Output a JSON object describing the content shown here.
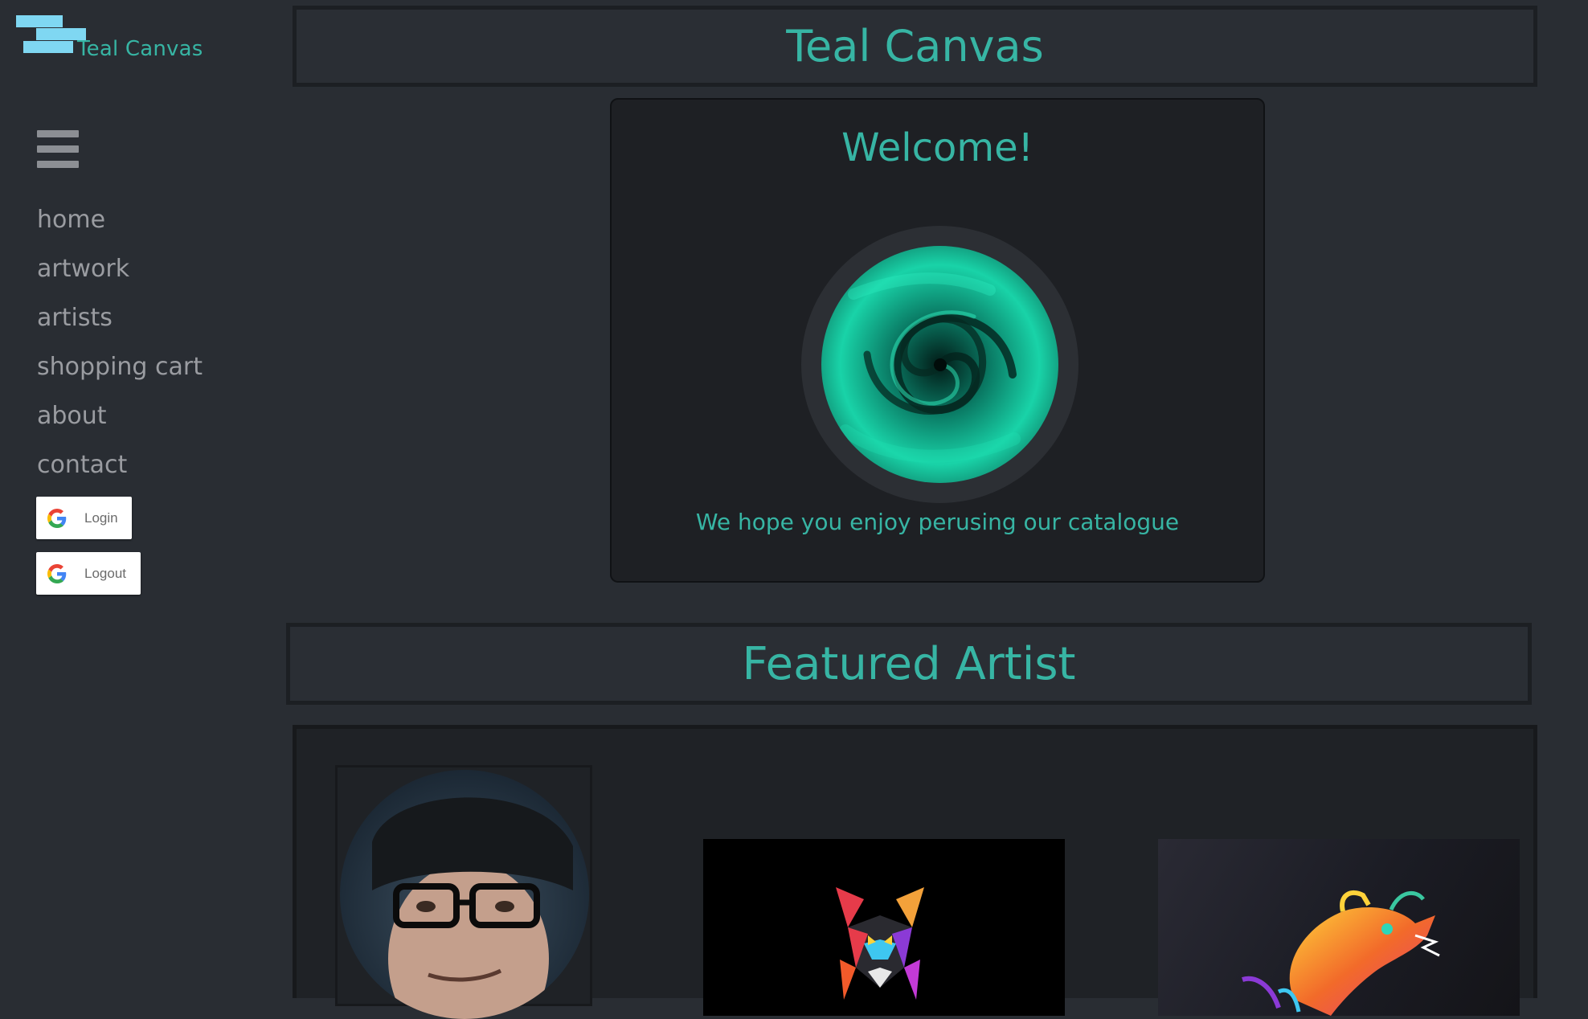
{
  "brand": {
    "logo_text": "Teal Canvas"
  },
  "sidebar": {
    "nav": [
      {
        "label": "home"
      },
      {
        "label": "artwork"
      },
      {
        "label": "artists"
      },
      {
        "label": "shopping cart"
      },
      {
        "label": "about"
      },
      {
        "label": "contact"
      }
    ],
    "login_label": "Login",
    "logout_label": "Logout"
  },
  "header": {
    "title": "Teal Canvas"
  },
  "welcome": {
    "title": "Welcome!",
    "tagline": "We hope you enjoy perusing our catalogue"
  },
  "featured": {
    "title": "Featured Artist"
  },
  "icons": [
    "menu-icon",
    "google-icon",
    "swirl-image",
    "artist-avatar",
    "wolf-artwork",
    "dragon-artwork"
  ],
  "colors": {
    "accent": "#37b5a4",
    "background": "#292d33",
    "card": "#1e2024",
    "logo_bars": "#7fd7f2",
    "nav_text": "#9a9ca1"
  }
}
